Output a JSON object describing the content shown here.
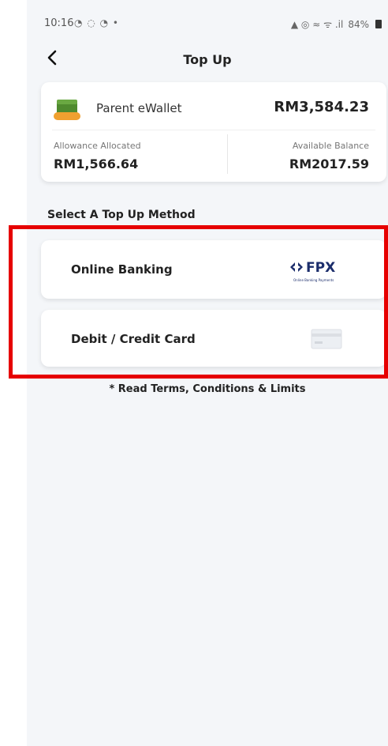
{
  "status_bar": {
    "time": "10:16",
    "left_icons": "◔ ◌ ◔ •",
    "signal_text": "▲ ◎ ≈ ᯤ .il",
    "battery": "84%"
  },
  "header": {
    "title": "Top Up",
    "back_icon": "chevron-left-icon"
  },
  "wallet": {
    "name": "Parent eWallet",
    "total": "RM3,584.23",
    "allocated_label": "Allowance Allocated",
    "allocated_value": "RM1,566.64",
    "available_label": "Available Balance",
    "available_value": "RM2017.59"
  },
  "methods": {
    "section_title": "Select A Top Up Method",
    "items": [
      {
        "label": "Online Banking",
        "logo_text": "FPX",
        "logo_subtext": "Online Banking Payments"
      },
      {
        "label": "Debit / Credit Card",
        "icon": "credit-card-icon"
      }
    ]
  },
  "terms_link": "* Read Terms, Conditions & Limits",
  "colors": {
    "background": "#f4f6f9",
    "highlight": "#e60000",
    "fpx_blue": "#1b2d6b",
    "wallet_green": "#4f8a2e",
    "wallet_orange": "#f0a030"
  }
}
